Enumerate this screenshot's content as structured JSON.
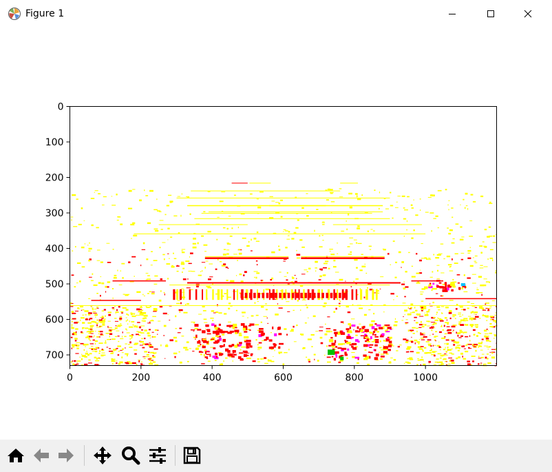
{
  "window": {
    "title": "Figure 1",
    "icon": "matplotlib-icon",
    "controls": [
      "minimize-icon",
      "maximize-icon",
      "close-icon"
    ]
  },
  "chart_data": {
    "type": "image",
    "title": "",
    "xlabel": "",
    "ylabel": "",
    "xlim": [
      0,
      1200
    ],
    "ylim": [
      730,
      0
    ],
    "x_ticks": [
      "0",
      "200",
      "400",
      "600",
      "800",
      "1000"
    ],
    "y_ticks": [
      "0",
      "100",
      "200",
      "300",
      "400",
      "500",
      "600",
      "700"
    ],
    "x_tick_values": [
      0,
      200,
      400,
      600,
      800,
      1000
    ],
    "y_tick_values": [
      0,
      100,
      200,
      300,
      400,
      500,
      600,
      700
    ],
    "colors": {
      "background": "#ffffff",
      "yellow": "#ffff00",
      "red": "#ff0000",
      "magenta": "#ff00ff",
      "green": "#00c000",
      "cyan": "#00c0ff"
    }
  },
  "toolbar": {
    "buttons": [
      "home-icon",
      "back-icon",
      "forward-icon",
      "pan-icon",
      "zoom-icon",
      "configure-subplots-icon",
      "save-icon"
    ]
  }
}
